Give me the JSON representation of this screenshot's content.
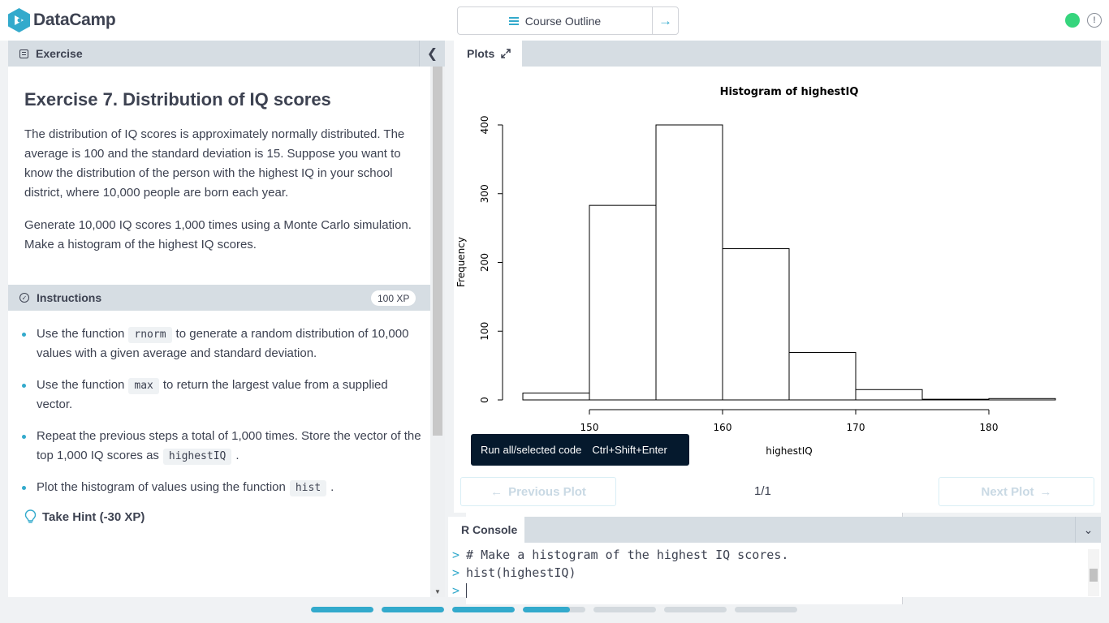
{
  "brand": {
    "name": "DataCamp",
    "color": "#33aacc"
  },
  "topnav": {
    "prev_icon": "arrow-left-icon",
    "next_icon": "arrow-right-icon",
    "outline_label": "Course Outline",
    "status_color": "#36d57d",
    "alert_glyph": "!"
  },
  "exercise_panel": {
    "header": "Exercise",
    "title": "Exercise 7. Distribution of IQ scores",
    "paragraph_1": "The distribution of IQ scores is approximately normally distributed. The average is 100 and the standard deviation is 15. Suppose you want to know the distribution of the person with the highest IQ in your school district, where 10,000 people are born each year.",
    "paragraph_2": "Generate 10,000 IQ scores 1,000 times using a Monte Carlo simulation. Make a histogram of the highest IQ scores."
  },
  "instructions": {
    "header": "Instructions",
    "xp": "100 XP",
    "items": [
      {
        "before": "Use the function",
        "code": "rnorm",
        "after": "to generate a random distribution of 10,000 values with a given average and standard deviation."
      },
      {
        "before": "Use the function",
        "code": "max",
        "after": "to return the largest value from a supplied vector."
      },
      {
        "before": "Repeat the previous steps a total of 1,000 times. Store the vector of the top 1,000 IQ scores as",
        "code": "highestIQ",
        "after": "."
      },
      {
        "before": "Plot the histogram of values using the function",
        "code": "hist",
        "after": "."
      }
    ],
    "hint": "Take Hint (-30 XP)"
  },
  "plots_panel": {
    "tab": "Plots",
    "previous": "Previous Plot",
    "next": "Next Plot",
    "page": "1/1",
    "tooltip_label": "Run all/selected code",
    "tooltip_shortcut": "Ctrl+Shift+Enter"
  },
  "chart_data": {
    "type": "bar",
    "title": "Histogram of highestIQ",
    "xlabel": "highestIQ",
    "ylabel": "Frequency",
    "bins": [
      {
        "from": 145,
        "to": 150,
        "count": 10
      },
      {
        "from": 150,
        "to": 155,
        "count": 283
      },
      {
        "from": 155,
        "to": 160,
        "count": 400
      },
      {
        "from": 160,
        "to": 165,
        "count": 220
      },
      {
        "from": 165,
        "to": 170,
        "count": 69
      },
      {
        "from": 170,
        "to": 175,
        "count": 15
      },
      {
        "from": 175,
        "to": 180,
        "count": 1
      },
      {
        "from": 180,
        "to": 185,
        "count": 2
      }
    ],
    "xticks": [
      150,
      160,
      170,
      180
    ],
    "yticks": [
      0,
      100,
      200,
      300,
      400
    ],
    "xlim": [
      145,
      185
    ],
    "ylim": [
      0,
      400
    ],
    "grid": false
  },
  "console": {
    "tab": "R Console",
    "prompt": ">",
    "lines": [
      "# Make a histogram of the highest IQ scores.",
      "hist(highestIQ)",
      ""
    ]
  },
  "progress": {
    "segments": [
      1,
      1,
      1,
      0.75,
      0,
      0,
      0
    ]
  }
}
